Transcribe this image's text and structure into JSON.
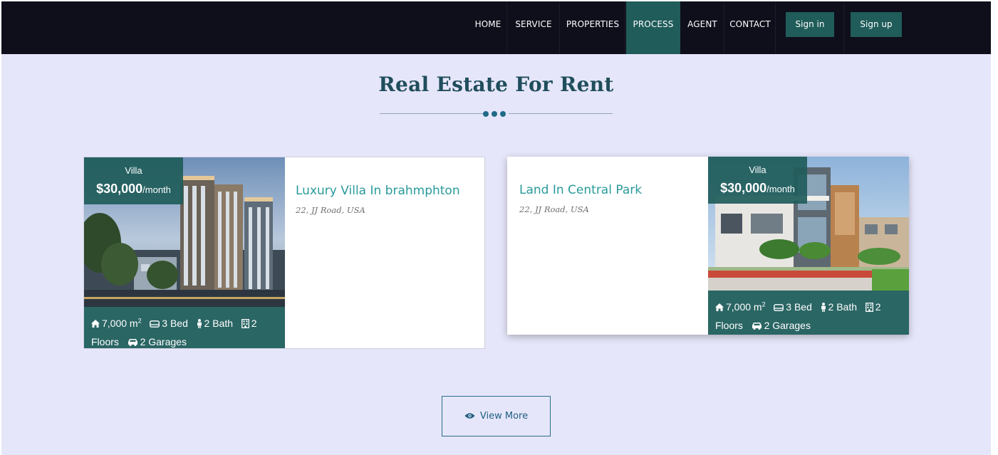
{
  "nav": {
    "items": [
      {
        "label": "HOME"
      },
      {
        "label": "SERVICE"
      },
      {
        "label": "PROPERTIES"
      },
      {
        "label": "PROCESS",
        "active": true
      },
      {
        "label": "AGENT"
      },
      {
        "label": "CONTACT"
      }
    ],
    "signin_label": "Sign in",
    "signup_label": "Sign up"
  },
  "section": {
    "title": "Real Estate For Rent"
  },
  "listings": [
    {
      "type": "Villa",
      "price": "$30,000",
      "period": "/month",
      "title": "Luxury Villa In brahmphton",
      "address": "22, JJ Road, USA",
      "area": "7,000 m",
      "area_sup": "2",
      "beds": "3 Bed",
      "baths": "2 Bath",
      "floors_num": "2",
      "floors_label": "Floors",
      "garages": "2 Garages"
    },
    {
      "type": "Villa",
      "price": "$30,000",
      "period": "/month",
      "title": "Land In Central Park",
      "address": "22, JJ Road, USA",
      "area": "7,000 m",
      "area_sup": "2",
      "beds": "3 Bed",
      "baths": "2 Bath",
      "floors_num": "2",
      "floors_label": "Floors",
      "garages": "2 Garages"
    }
  ],
  "view_more_label": "View More",
  "colors": {
    "nav_bg": "#0f0f1c",
    "accent_teal": "#1f5c5a",
    "page_bg": "#e6e6fa",
    "title": "#1f4d5c",
    "card_title": "#2a9a9b"
  },
  "icons": [
    "home-icon",
    "bed-icon",
    "bath-icon",
    "building-icon",
    "car-icon",
    "eye-icon"
  ]
}
